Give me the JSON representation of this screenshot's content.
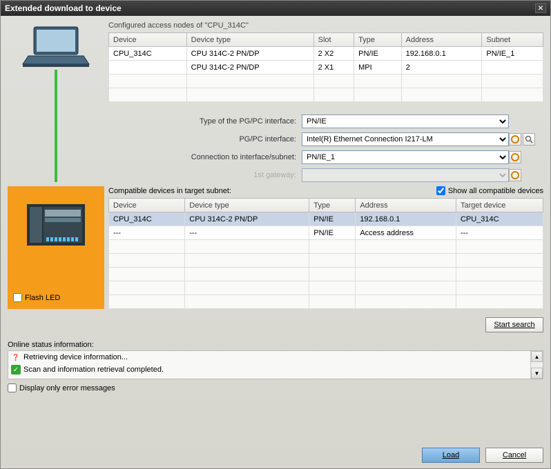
{
  "title": "Extended download to device",
  "configured_label": "Configured access nodes of \"CPU_314C\"",
  "nodes_table": {
    "headers": [
      "Device",
      "Device type",
      "Slot",
      "Type",
      "Address",
      "Subnet"
    ],
    "rows": [
      [
        "CPU_314C",
        "CPU 314C-2 PN/DP",
        "2 X2",
        "PN/IE",
        "192.168.0.1",
        "PN/IE_1"
      ],
      [
        "",
        "CPU 314C-2 PN/DP",
        "2 X1",
        "MPI",
        "2",
        ""
      ]
    ]
  },
  "form": {
    "type_label": "Type of the PG/PC interface:",
    "type_value": "PN/IE",
    "iface_label": "PG/PC interface:",
    "iface_value": "Intel(R) Ethernet Connection I217-LM",
    "conn_label": "Connection to interface/subnet:",
    "conn_value": "PN/IE_1",
    "gw_label": "1st gateway:",
    "gw_value": ""
  },
  "compat_label": "Compatible devices in target subnet:",
  "show_all_label": "Show all compatible devices",
  "show_all_checked": true,
  "compat_table": {
    "headers": [
      "Device",
      "Device type",
      "Type",
      "Address",
      "Target device"
    ],
    "rows": [
      {
        "cells": [
          "CPU_314C",
          "CPU 314C-2 PN/DP",
          "PN/IE",
          "192.168.0.1",
          "CPU_314C"
        ],
        "selected": true
      },
      {
        "cells": [
          "---",
          "---",
          "PN/IE",
          "Access address",
          "---"
        ],
        "selected": false
      }
    ]
  },
  "flash_label": "Flash LED",
  "flash_checked": false,
  "start_search_label": "Start search",
  "status_label": "Online status information:",
  "status_lines": [
    {
      "icon": "info",
      "text": "Retrieving device information..."
    },
    {
      "icon": "check",
      "text": "Scan and information retrieval completed."
    }
  ],
  "errors_only_label": "Display only error messages",
  "errors_only_checked": false,
  "load_label": "Load",
  "cancel_label": "Cancel"
}
